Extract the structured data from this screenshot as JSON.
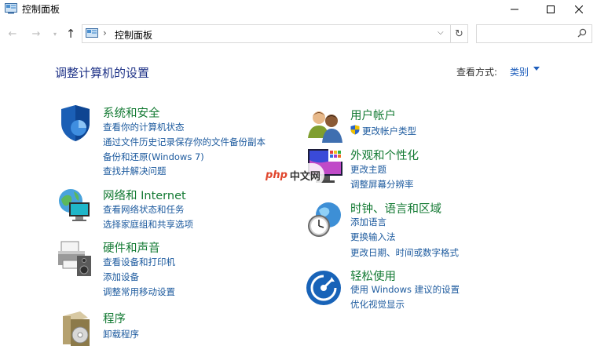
{
  "window": {
    "title": "控制面板"
  },
  "address": {
    "crumb": "控制面板",
    "separator": "›"
  },
  "header": {
    "heading": "调整计算机的设置",
    "view_by_label": "查看方式:",
    "view_by_value": "类别"
  },
  "categories_left": [
    {
      "title": "系统和安全",
      "links": [
        "查看你的计算机状态",
        "通过文件历史记录保存你的文件备份副本",
        "备份和还原(Windows 7)",
        "查找并解决问题"
      ]
    },
    {
      "title": "网络和 Internet",
      "links": [
        "查看网络状态和任务",
        "选择家庭组和共享选项"
      ]
    },
    {
      "title": "硬件和声音",
      "links": [
        "查看设备和打印机",
        "添加设备",
        "调整常用移动设置"
      ]
    },
    {
      "title": "程序",
      "links": [
        "卸载程序"
      ]
    }
  ],
  "categories_right": [
    {
      "title": "用户帐户",
      "links": [
        "更改帐户类型"
      ]
    },
    {
      "title": "外观和个性化",
      "links": [
        "更改主题",
        "调整屏幕分辨率"
      ]
    },
    {
      "title": "时钟、语言和区域",
      "links": [
        "添加语言",
        "更换输入法",
        "更改日期、时间或数字格式"
      ]
    },
    {
      "title": "轻松使用",
      "links": [
        "使用 Windows 建议的设置",
        "优化视觉显示"
      ]
    }
  ],
  "watermark": {
    "php": "php",
    "cn": "中文网"
  },
  "icons": {
    "system_security": "shield-icon",
    "network": "globe-network-icon",
    "hardware": "printer-speaker-icon",
    "programs": "program-box-icon",
    "user_accounts": "users-icon",
    "appearance": "monitor-palette-icon",
    "clock_region": "clock-globe-icon",
    "ease_access": "ease-of-access-icon"
  },
  "colors": {
    "category_title": "#137a33",
    "link": "#1c5a9e",
    "heading": "#1e3287"
  }
}
